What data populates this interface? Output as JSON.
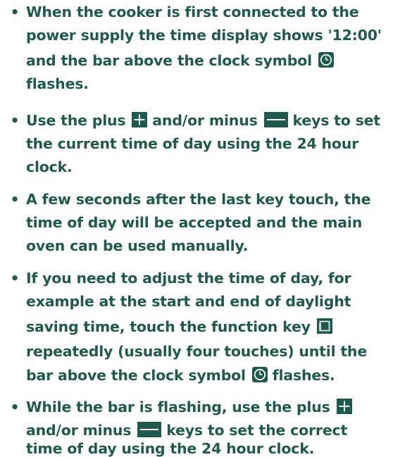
{
  "bullets": [
    {
      "lines": [
        "When the cooker is first connected to the",
        "power supply the time display shows '12:00'",
        "and the bar above the clock symbol",
        "flashes."
      ]
    },
    {
      "lines": [
        "Use the plus",
        "and/or minus",
        "keys to set",
        "the current time of day using the 24 hour",
        "clock."
      ]
    },
    {
      "lines": [
        "A few seconds after the last key touch, the",
        "time of day will be accepted and the main",
        "oven can be used manually."
      ]
    },
    {
      "lines": [
        "If you need to adjust the time of day, for",
        "example at the start and end of daylight",
        "saving time, touch the function key",
        "repeatedly (usually four touches) until the",
        "bar above the clock symbol",
        "flashes."
      ]
    },
    {
      "lines": [
        "While the bar is flashing, use the plus",
        "and/or minus",
        "keys to set the correct",
        "time of day using the 24 hour clock."
      ]
    }
  ],
  "bullet_glyph": "•",
  "icons": {
    "clock": "clock-icon",
    "plus": "plus-icon",
    "minus": "minus-icon",
    "function": "function-key-icon"
  },
  "colors": {
    "text": "#1f5a4e",
    "icon_bg": "#1f5a4e",
    "icon_fg": "#ffffff"
  }
}
